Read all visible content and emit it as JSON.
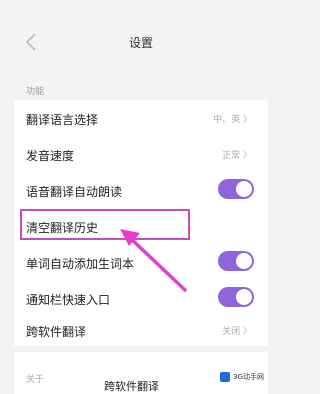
{
  "header": {
    "title": "设置"
  },
  "section_function": {
    "label": "功能"
  },
  "rows": [
    {
      "label": "翻译语言选择",
      "value": "中、英 〉"
    },
    {
      "label": "发音速度",
      "value": "正常 〉"
    },
    {
      "label": "语音翻译自动朗读",
      "toggle": true
    },
    {
      "label": "清空翻译历史"
    },
    {
      "label": "单词自动添加生词本",
      "toggle": true
    },
    {
      "label": "通知栏快速入口",
      "toggle": true
    },
    {
      "label": "跨软件翻译",
      "value": "关闭 〉"
    }
  ],
  "section_about": {
    "label": "关于"
  },
  "caption": "跨软件翻译",
  "watermark": {
    "text": "3G动手网"
  },
  "colors": {
    "toggle_on": "#8f66d9",
    "highlight": "#c64cc0",
    "arrow": "#e23fd0"
  }
}
